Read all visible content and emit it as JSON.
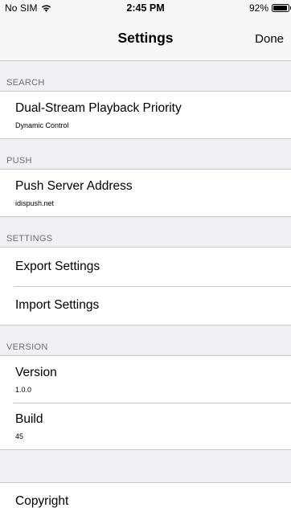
{
  "status_bar": {
    "carrier": "No SIM",
    "time": "2:45 PM",
    "battery_percent": "92%",
    "battery_level": 0.92,
    "signal_icon": "wifi-icon"
  },
  "nav": {
    "title": "Settings",
    "done_label": "Done"
  },
  "sections": {
    "search": {
      "header": "SEARCH",
      "items": [
        {
          "title": "Dual-Stream Playback Priority",
          "subtitle": "Dynamic Control"
        }
      ]
    },
    "push": {
      "header": "PUSH",
      "items": [
        {
          "title": "Push Server Address",
          "subtitle": "idispush.net"
        }
      ]
    },
    "settings": {
      "header": "SETTINGS",
      "items": [
        {
          "title": "Export Settings"
        },
        {
          "title": "Import Settings"
        }
      ]
    },
    "version": {
      "header": "VERSION",
      "items": [
        {
          "title": "Version",
          "subtitle": "1.0.0"
        },
        {
          "title": "Build",
          "subtitle": "45"
        }
      ]
    }
  },
  "partial_item": {
    "title": "Copyright"
  }
}
